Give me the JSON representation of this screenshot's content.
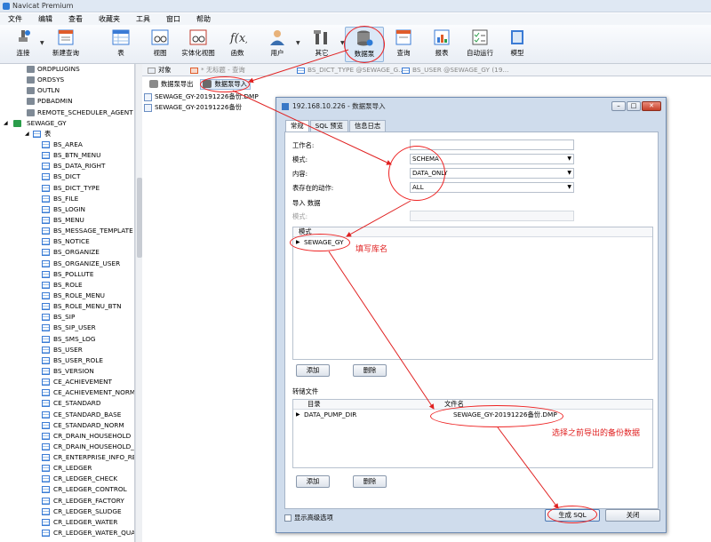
{
  "window": {
    "title": "Navicat Premium"
  },
  "menu": [
    "文件",
    "编辑",
    "查看",
    "收藏夹",
    "工具",
    "窗口",
    "帮助"
  ],
  "toolbar": {
    "connect": "连接",
    "new_query": "新建查询",
    "table": "表",
    "view": "视图",
    "mview": "实体化视图",
    "function": "函数",
    "user": "用户",
    "other": "其它",
    "datapump": "数据泵",
    "query": "查询",
    "report": "报表",
    "automation": "自动运行",
    "model": "模型"
  },
  "tree": {
    "schemas_top": [
      "ORDPLUGINS",
      "ORDSYS",
      "OUTLN",
      "PDBADMIN",
      "REMOTE_SCHEDULER_AGENT"
    ],
    "current_schema": "SEWAGE_GY",
    "tables_label": "表",
    "tables": [
      "BS_AREA",
      "BS_BTN_MENU",
      "BS_DATA_RIGHT",
      "BS_DICT",
      "BS_DICT_TYPE",
      "BS_FILE",
      "BS_LOGIN",
      "BS_MENU",
      "BS_MESSAGE_TEMPLATE",
      "BS_NOTICE",
      "BS_ORGANIZE",
      "BS_ORGANIZE_USER",
      "BS_POLLUTE",
      "BS_ROLE",
      "BS_ROLE_MENU",
      "BS_ROLE_MENU_BTN",
      "BS_SIP",
      "BS_SIP_USER",
      "BS_SMS_LOG",
      "BS_USER",
      "BS_USER_ROLE",
      "BS_VERSION",
      "CE_ACHIEVEMENT",
      "CE_ACHIEVEMENT_NORM",
      "CE_STANDARD",
      "CE_STANDARD_BASE",
      "CE_STANDARD_NORM",
      "CR_DRAIN_HOUSEHOLD",
      "CR_DRAIN_HOUSEHOLD_A",
      "CR_ENTERPRISE_INFO_RE",
      "CR_LEDGER",
      "CR_LEDGER_CHECK",
      "CR_LEDGER_CONTROL",
      "CR_LEDGER_FACTORY",
      "CR_LEDGER_SLUDGE",
      "CR_LEDGER_WATER",
      "CR_LEDGER_WATER_QUAL"
    ]
  },
  "tabs": [
    "对象",
    "* 无标题 - 查询",
    "BS_DICT_TYPE @SEWAGE_G...",
    "BS_USER @SEWAGE_GY (19..."
  ],
  "object_bar": {
    "export": "数据泵导出",
    "import": "数据泵导入"
  },
  "files": [
    "SEWAGE_GY-20191226备份.DMP",
    "SEWAGE_GY-20191226备份"
  ],
  "dialog": {
    "title": "192.168.10.226 - 数据泵导入",
    "tabs": [
      "常规",
      "SQL 预览",
      "信息日志"
    ],
    "job_name_label": "工作名:",
    "mode_label": "模式:",
    "mode_value": "SCHEMA",
    "content_label": "内容:",
    "content_value": "DATA_ONLY",
    "table_exists_label": "表存在的动作:",
    "table_exists_value": "ALL",
    "import_data_label": "导入 数据",
    "schema_label": "模式:",
    "schema_grid_header": "模式",
    "schema_value": "SEWAGE_GY",
    "add": "添加",
    "delete": "删除",
    "dump_files_label": "转储文件",
    "col_dir": "目录",
    "col_filename": "文件名",
    "dir_value": "DATA_PUMP_DIR",
    "filename_value": "SEWAGE_GY-20191226备份.DMP",
    "show_advanced": "显示高级选项",
    "generate_sql": "生成 SQL",
    "close": "关闭"
  },
  "annotations": {
    "fill_schema": "填写库名",
    "choose_backup": "选择之前导出的备份数据"
  },
  "colors": {
    "accent": "#e02020",
    "toolbar_bg": "#e9eef5",
    "dialog_bg": "#cfdcec"
  }
}
